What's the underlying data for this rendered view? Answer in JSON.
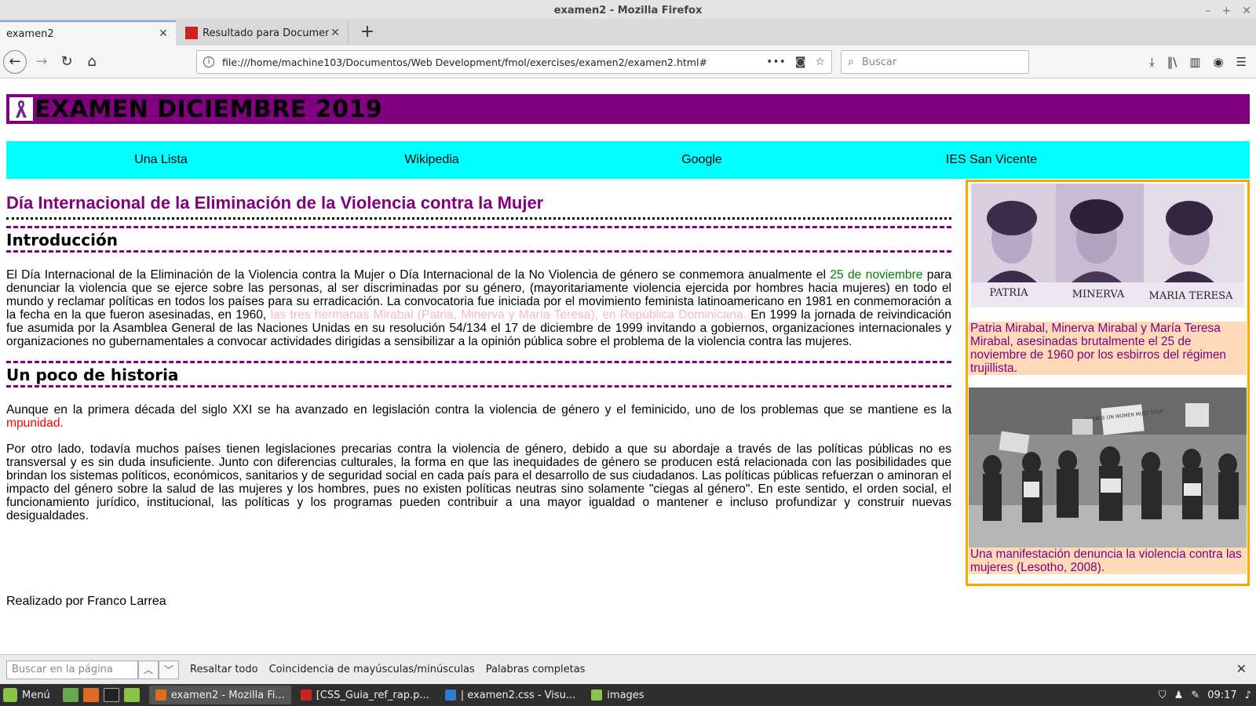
{
  "window": {
    "title": "examen2 - Mozilla Firefox",
    "minimize": "–",
    "maximize": "+",
    "close": "✕"
  },
  "tabs": [
    {
      "label": "examen2",
      "active": true
    },
    {
      "label": "Resultado para Documento en",
      "active": false
    }
  ],
  "tab_close": "✕",
  "new_tab": "+",
  "nav": {
    "back": "←",
    "forward": "→",
    "reload": "↻",
    "home": "⌂",
    "url": "file:///home/machine103/Documentos/Web Development/fmol/exercises/examen2/examen2.html#",
    "info": "i",
    "more": "•••",
    "pocket": "◙",
    "bookmark": "☆",
    "search_placeholder": "Buscar",
    "search_glyph": "⌕",
    "download": "⤓",
    "library": "‖\\",
    "sidebar": "▥",
    "account": "◉",
    "menu": "☰"
  },
  "page": {
    "banner_title": "EXAMEN DICIEMBRE 2019",
    "menu": [
      "Una Lista",
      "Wikipedia",
      "Google",
      "IES San Vicente"
    ],
    "title": "Día Internacional de la Eliminación de la Violencia contra la Mujer",
    "sections": [
      {
        "heading": "Introducción",
        "p1_a": "El Día Internacional de la Eliminación de la Violencia contra la Mujer o Día Internacional de la No Violencia de género se conmemora anualmente el ",
        "p1_date": "25 de noviembre",
        "p1_b": " para denunciar la violencia que se ejerce sobre las personas, al ser discriminadas por su género, (mayoritariamente violencia ejercida por hombres hacia mujeres) en todo el mundo y reclamar políticas en todos los países para su erradicación. La convocatoria fue iniciada por el movimiento feminista latinoamericano en 1981 en conmemoración a la fecha en la que fueron asesinadas, en 1960, ",
        "p1_sisters": "las tres hermanas Mirabal (Patria, Minerva y María Teresa), en República Dominicana.",
        "p1_c": " En 1999 la jornada de reivindicación fue asumida por la Asamblea General de las Naciones Unidas en su resolución 54/134 el 17 de diciembre de 1999 invitando a gobiernos, organizaciones internacionales y organizaciones no gubernamentales a convocar actividades dirigidas a sensibilizar a la opinión pública sobre el problema de la violencia contra las mujeres."
      },
      {
        "heading": "Un poco de historia",
        "p2_a": "Aunque en la primera década del siglo XXI se ha avanzado en legislación contra la violencia de género y el feminicido, uno de los problemas que se mantiene es la ",
        "p2_red": "mpunidad.",
        "p3": "Por otro lado, todavía muchos países tienen legislaciones precarias contra la violencia de género, debido a que su abordaje a través de las políticas públicas no es transversal y es sin duda insuficiente. Junto con diferencias culturales, la forma en que las inequidades de género se producen está relacionada con las posibilidades que brindan los sistemas políticos, económicos, sanitarios y de seguridad social en cada país para el desarrollo de sus ciudadanos. Las políticas públicas refuerzan o aminoran el impacto del género sobre la salud de las mujeres y los hombres, pues no existen políticas neutras sino solamente \"ciegas al género\". En este sentido, el orden social, el funcionamiento jurídico, institucional, las políticas y los programas pueden contribuir a una mayor igualdad o mantener e incluso profundizar y construir nuevas desigualdades."
      }
    ],
    "footer": "Realizado por Franco Larrea",
    "aside": {
      "photo1_names": [
        "PATRIA",
        "MINERVA",
        "MARIA TERESA"
      ],
      "caption1": "Patria Mirabal, Minerva Mirabal y María Teresa Mirabal, asesinadas brutalmente el 25 de noviembre de 1960 por los esbirros del régimen trujillista.",
      "photo2_signs": [
        "VIOLENCE ON WOMEN MUST STOP"
      ],
      "caption2": "Una manifestación denuncia la violencia contra las mujeres (Lesotho, 2008)."
    }
  },
  "findbar": {
    "placeholder": "Buscar en la página",
    "up": "︿",
    "down": "﹀",
    "highlight_all": "Resaltar todo",
    "match_case": "Coincidencia de mayúsculas/minúsculas",
    "whole_words": "Palabras completas",
    "close": "✕"
  },
  "taskbar": {
    "menu_label": "Menú",
    "items": [
      {
        "label": "examen2 - Mozilla Fi...",
        "active": true
      },
      {
        "label": "[CSS_Guia_ref_rap.p...",
        "active": false
      },
      {
        "label": "| examen2.css - Visu...",
        "active": false
      },
      {
        "label": "images",
        "active": false
      }
    ],
    "tray_shield": "⛉",
    "tray_user": "♟",
    "tray_pen": "✎",
    "clock": "09:17",
    "volume": "♪"
  },
  "colors": {
    "banner": "#800080",
    "menu_bg": "#00ffff",
    "heading_purple": "#800080",
    "aside_border": "#ffa500",
    "caption_bg": "#ffdab9"
  }
}
